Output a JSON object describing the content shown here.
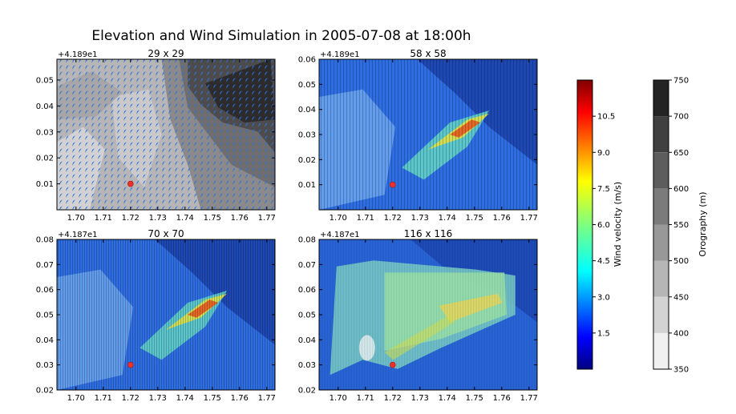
{
  "figure": {
    "title": "Elevation and Wind Simulation in 2005-07-08 at 18:00h"
  },
  "chart_data": [
    {
      "type": "heatmap",
      "title": "29 x 29",
      "resolution": 29,
      "layer": "orography_with_wind_arrows",
      "offset_label": "+4.189e1",
      "x_ticks": [
        "1.70",
        "1.71",
        "1.72",
        "1.73",
        "1.74",
        "1.75",
        "1.76",
        "1.77"
      ],
      "y_ticks": [
        "0.01",
        "0.02",
        "0.03",
        "0.04",
        "0.05"
      ],
      "xlim": [
        1.693,
        1.773
      ],
      "ylim": [
        0.0,
        0.058
      ],
      "marker": {
        "x": 1.72,
        "y": 0.01,
        "color": "#e8322a"
      }
    },
    {
      "type": "heatmap",
      "title": "58 x 58",
      "resolution": 58,
      "layer": "wind_velocity_over_orography",
      "offset_label": "+4.189e1",
      "x_ticks": [
        "1.70",
        "1.71",
        "1.72",
        "1.73",
        "1.74",
        "1.75",
        "1.76",
        "1.77"
      ],
      "y_ticks": [
        "0.01",
        "0.02",
        "0.03",
        "0.04",
        "0.05",
        "0.06"
      ],
      "xlim": [
        1.693,
        1.773
      ],
      "ylim": [
        0.0,
        0.06
      ],
      "marker": {
        "x": 1.72,
        "y": 0.01,
        "color": "#e8322a"
      }
    },
    {
      "type": "heatmap",
      "title": "70 x 70",
      "resolution": 70,
      "layer": "wind_velocity_over_orography",
      "offset_label": "+4.187e1",
      "x_ticks": [
        "1.70",
        "1.71",
        "1.72",
        "1.73",
        "1.74",
        "1.75",
        "1.76",
        "1.77"
      ],
      "y_ticks": [
        "0.02",
        "0.03",
        "0.04",
        "0.05",
        "0.06",
        "0.07",
        "0.08"
      ],
      "xlim": [
        1.693,
        1.773
      ],
      "ylim": [
        0.02,
        0.08
      ],
      "marker": {
        "x": 1.72,
        "y": 0.03,
        "color": "#e8322a"
      }
    },
    {
      "type": "heatmap",
      "title": "116 x 116",
      "resolution": 116,
      "layer": "wind_velocity_over_orography",
      "offset_label": "+4.187e1",
      "x_ticks": [
        "1.70",
        "1.71",
        "1.72",
        "1.73",
        "1.74",
        "1.75",
        "1.76",
        "1.77"
      ],
      "y_ticks": [
        "0.02",
        "0.03",
        "0.04",
        "0.05",
        "0.06",
        "0.07",
        "0.08"
      ],
      "xlim": [
        1.693,
        1.773
      ],
      "ylim": [
        0.02,
        0.08
      ],
      "marker": {
        "x": 1.72,
        "y": 0.03,
        "color": "#e8322a"
      }
    }
  ],
  "colorbars": [
    {
      "label": "Wind velocity (m/s)",
      "colormap": "jet",
      "range": [
        0,
        12
      ],
      "ticks": [
        "1.5",
        "3.0",
        "4.5",
        "6.0",
        "7.5",
        "9.0",
        "10.5"
      ],
      "tick_values": [
        1.5,
        3.0,
        4.5,
        6.0,
        7.5,
        9.0,
        10.5
      ]
    },
    {
      "label": "Orography (m)",
      "colormap": "gray_r",
      "range": [
        350,
        750
      ],
      "ticks": [
        "350",
        "400",
        "450",
        "500",
        "550",
        "600",
        "650",
        "700",
        "750"
      ],
      "tick_values": [
        350,
        400,
        450,
        500,
        550,
        600,
        650,
        700,
        750
      ]
    }
  ]
}
